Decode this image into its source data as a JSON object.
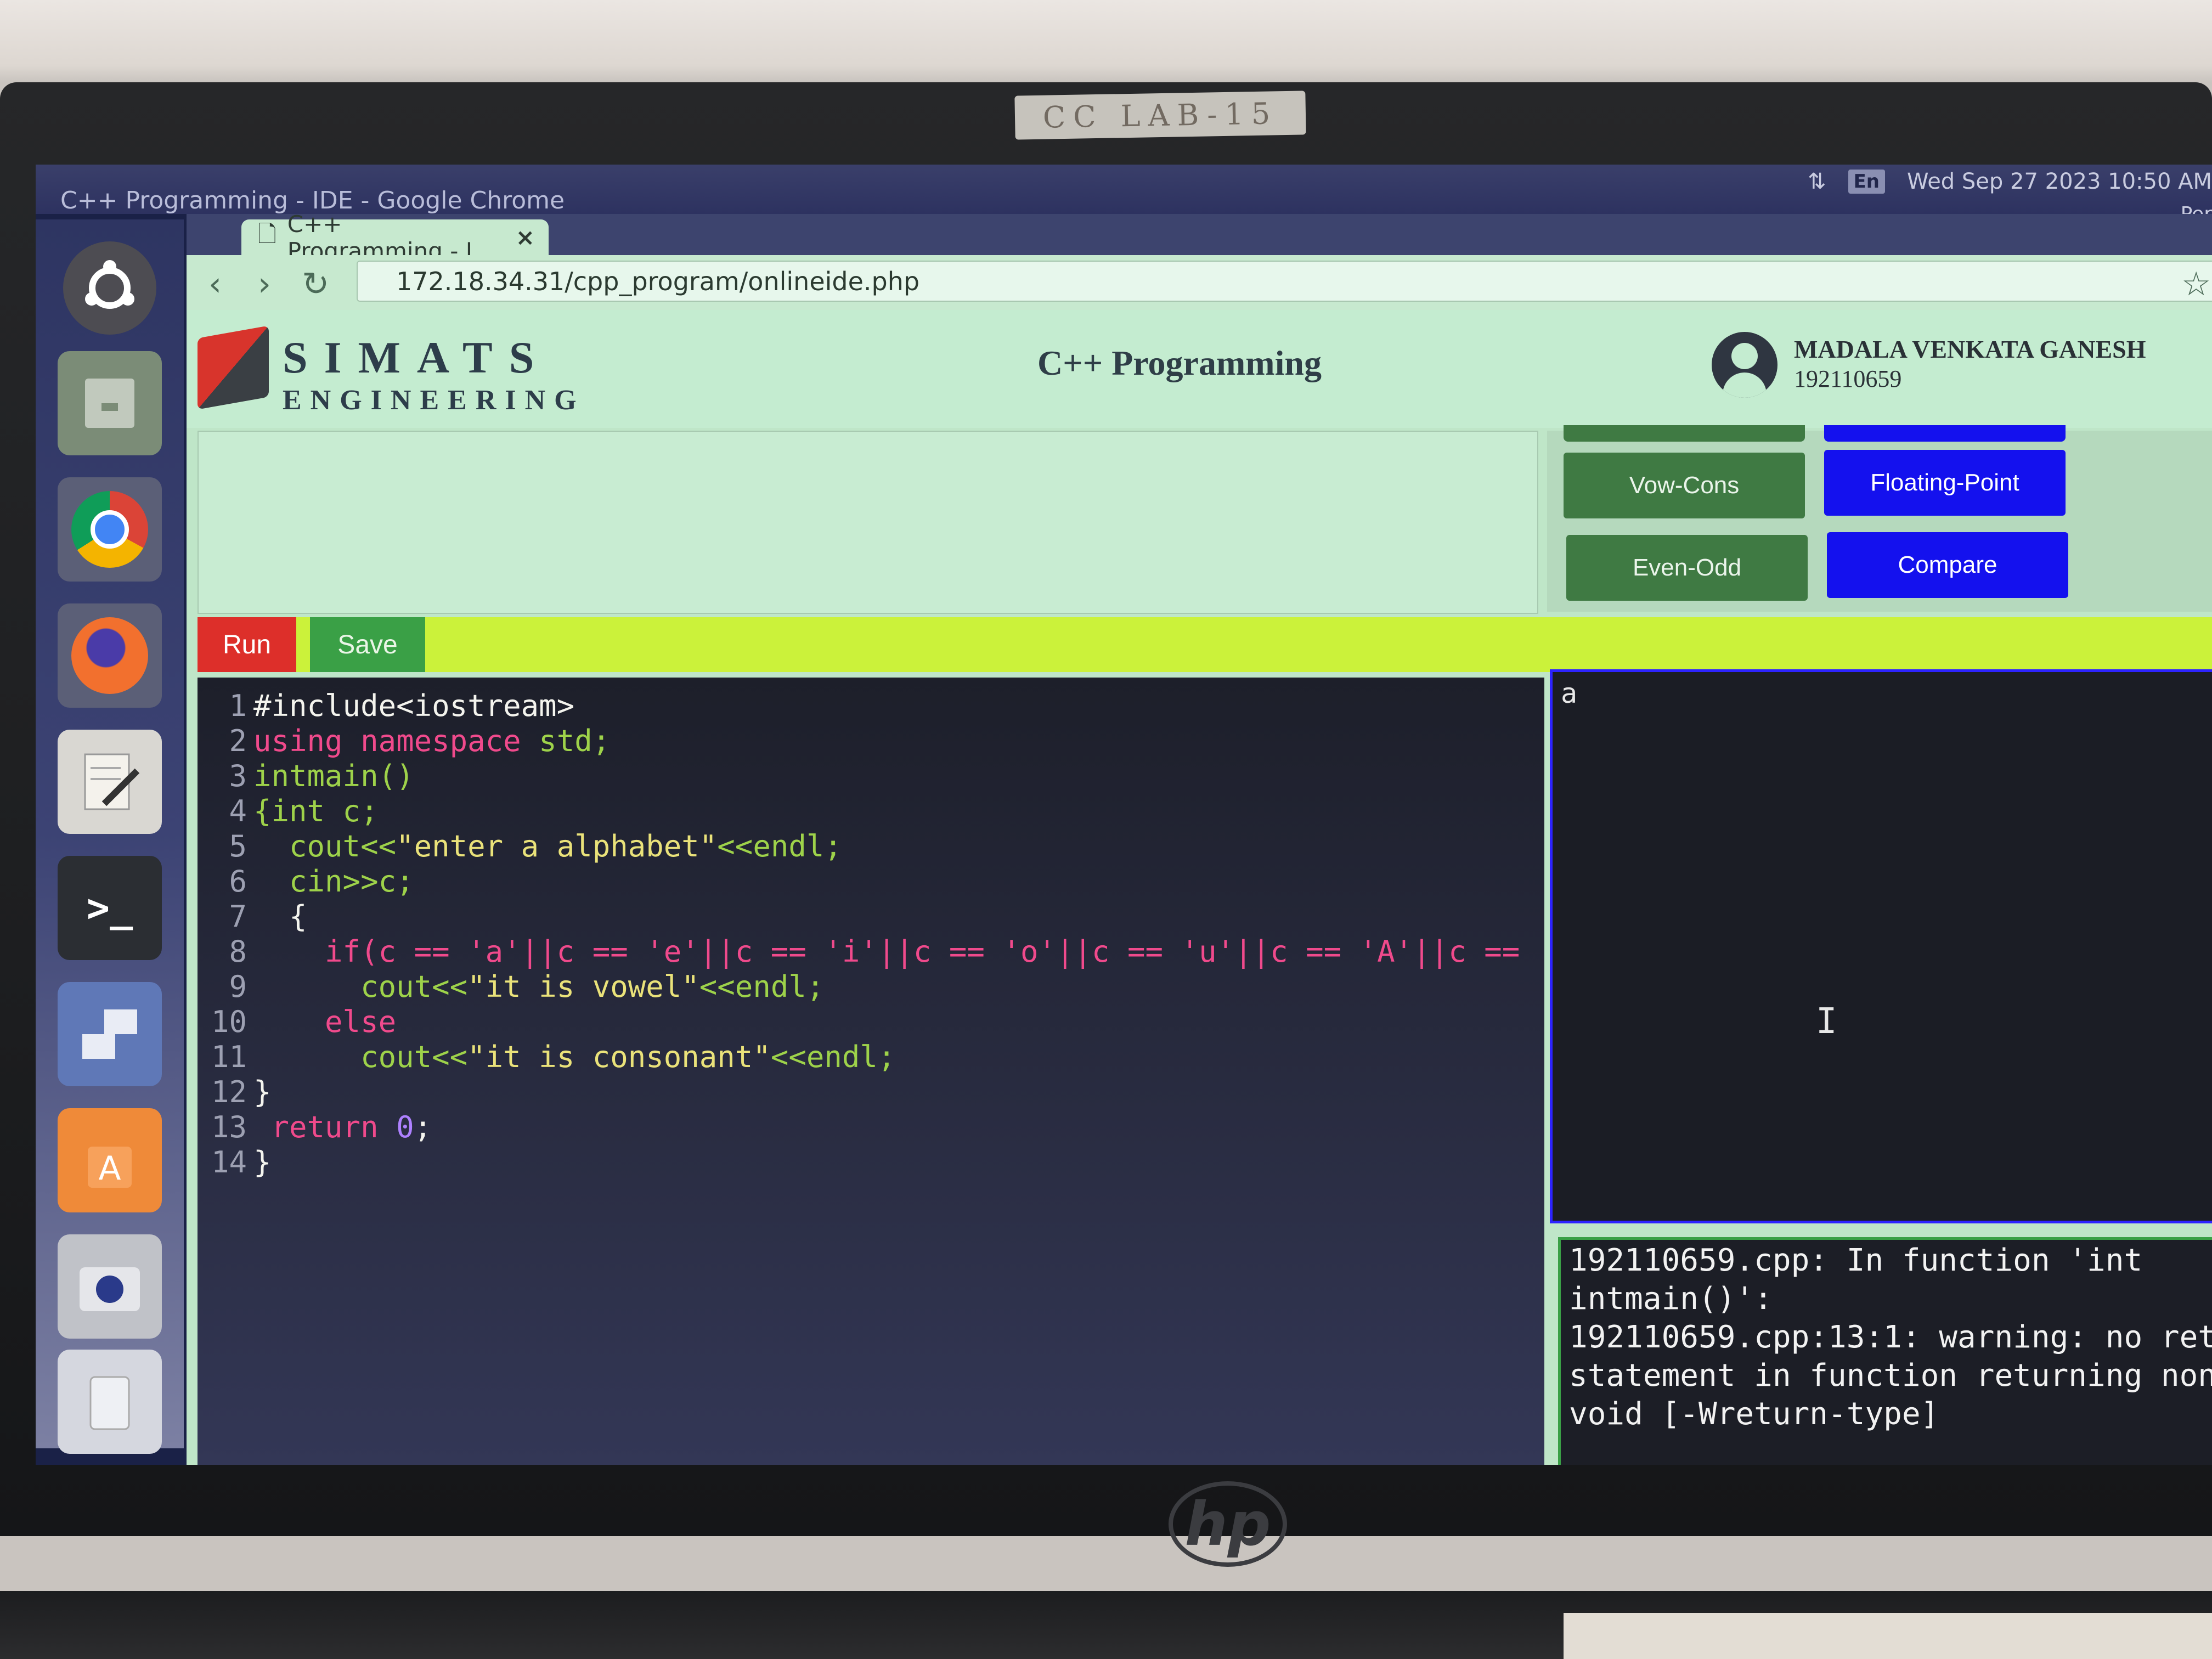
{
  "sticker_text": "CC LAB-15",
  "window_title": "C++ Programming - IDE - Google Chrome",
  "tray": {
    "lang": "En",
    "datetime": "Wed Sep 27 2023 10:50 AM",
    "extra": "Per"
  },
  "browser": {
    "tab_title": "C++ Programming - I",
    "tab_close": "×",
    "url": "172.18.34.31/cpp_program/onlineide.php"
  },
  "header": {
    "logo_line1": "SIMATS",
    "logo_line2": "ENGINEERING",
    "title": "C++ Programming",
    "user_name": "MADALA VENKATA GANESH",
    "user_id": "192110659"
  },
  "programs": {
    "vow_cons": "Vow-Cons",
    "floating_point": "Floating-Point",
    "even_odd": "Even-Odd",
    "compare": "Compare"
  },
  "actions": {
    "run": "Run",
    "save": "Save"
  },
  "code": {
    "line_numbers": [
      "1",
      "2",
      "3",
      "4",
      "5",
      "6",
      "7",
      "8",
      "9",
      "10",
      "11",
      "12",
      "13",
      "14"
    ],
    "l1": "#include<iostream>",
    "l2_kw": "using namespace",
    "l2_rest": " std;",
    "l3": "intmain()",
    "l4": "{int c;",
    "l5_a": "  cout<<",
    "l5_str": "\"enter a alphabet\"",
    "l5_b": "<<endl;",
    "l6": "  cin>>c;",
    "l7": "  {",
    "l8": "    if(c == 'a'||c == 'e'||c == 'i'||c == 'o'||c == 'u'||c == 'A'||c ==",
    "l9_a": "      cout<<",
    "l9_str": "\"it is vowel\"",
    "l9_b": "<<endl;",
    "l10": "    else",
    "l11_a": "      cout<<",
    "l11_str": "\"it is consonant\"",
    "l11_b": "<<endl;",
    "l12": "}",
    "l13_kw": " return",
    "l13_num": " 0",
    "l13_end": ";",
    "l14": "}"
  },
  "input_value": "a",
  "input_cursor": "I",
  "output_lines": [
    "192110659.cpp: In function 'int",
    "intmain()':",
    "192110659.cpp:13:1: warning: no ret",
    "statement in function returning non",
    "void [-Wreturn-type]"
  ],
  "monitor_brand": "hp"
}
